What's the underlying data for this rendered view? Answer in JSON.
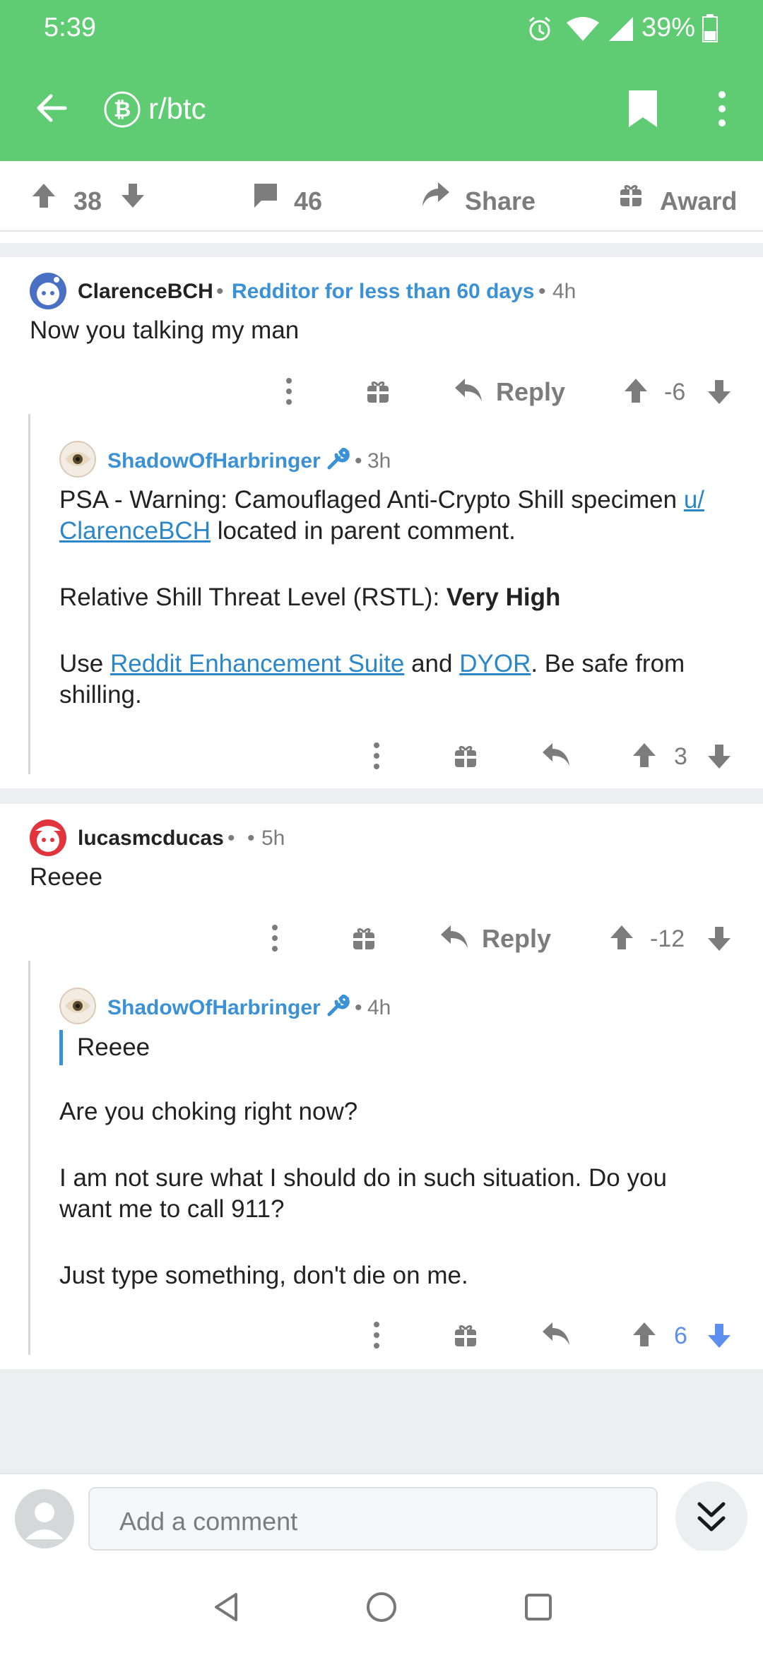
{
  "status": {
    "time": "5:39",
    "battery": "39%"
  },
  "header": {
    "title": "r/btc",
    "icons": [
      "back-arrow-icon",
      "bitcoin-icon",
      "bookmark-icon",
      "more-vertical-icon"
    ]
  },
  "post_actions": {
    "upvotes": "38",
    "comments": "46",
    "share": "Share",
    "award": "Award"
  },
  "comments": [
    {
      "author": "ClarenceBCH",
      "flair": "Redditor for less than 60 days",
      "age": "4h",
      "body": "Now you talking my man",
      "reply_label": "Reply",
      "score": "-6",
      "reply": {
        "author": "ShadowOfHarbringer",
        "age": "3h",
        "p1_text": "PSA - Warning: Camouflaged Anti-Crypto Shill specimen ",
        "p1_link1": "u/",
        "p1_link2": "ClarenceBCH",
        "p1_tail": " located in parent comment.",
        "p2_text": "Relative Shill Threat Level (RSTL): ",
        "p2_bold": "Very High",
        "p3_text": "Use ",
        "p3_link1": "Reddit Enhancement Suite",
        "p3_mid": " and ",
        "p3_link2": "DYOR",
        "p3_tail": ". Be safe from",
        "p3_line2": "shilling.",
        "score": "3"
      }
    },
    {
      "author": "lucasmcducas",
      "age": "5h",
      "body": "Reeee",
      "reply_label": "Reply",
      "score": "-12",
      "reply": {
        "author": "ShadowOfHarbringer",
        "age": "4h",
        "quote": "Reeee",
        "p1": "Are you choking right now?",
        "p2_line1": "I am not sure what I should do in such situation. Do you",
        "p2_line2": "want me to call 911?",
        "p3": "Just type something, don't die on me.",
        "score": "6"
      }
    }
  ],
  "composer": {
    "placeholder": "Add a comment"
  },
  "colors": {
    "header": "#5fcb73",
    "link": "#2b87c8",
    "flair": "#3b91d6",
    "upvoted": "#5c8fef"
  }
}
